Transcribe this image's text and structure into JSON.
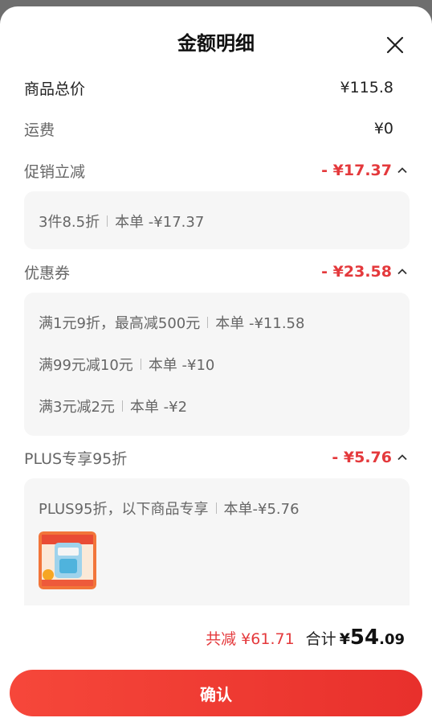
{
  "title": "金额明细",
  "close_icon": "close-icon",
  "rows": {
    "goods_total": {
      "label": "商品总价",
      "amount": "¥115.8"
    },
    "shipping": {
      "label": "运费",
      "amount": "¥0"
    },
    "promo": {
      "label": "促销立减",
      "amount": "- ¥17.37"
    },
    "coupon": {
      "label": "优惠券",
      "amount": "- ¥23.58"
    },
    "plus": {
      "label": "PLUS专享95折",
      "amount": "- ¥5.76"
    }
  },
  "promo_details": [
    {
      "text": "3件8.5折",
      "detail": "本单 -¥17.37"
    }
  ],
  "coupon_details": [
    {
      "text": "满1元9折，最高减500元",
      "detail": "本单 -¥11.58"
    },
    {
      "text": "满99元减10元",
      "detail": "本单 -¥10"
    },
    {
      "text": "满3元减2元",
      "detail": "本单 -¥2"
    }
  ],
  "plus_details": [
    {
      "text": "PLUS95折，以下商品专享",
      "detail": "本单-¥5.76"
    }
  ],
  "footer": {
    "saved": "共减 ¥61.71",
    "total_label": "合计",
    "total_yen": "¥",
    "total_int": "54",
    "total_dec": ".09",
    "confirm": "确认"
  },
  "colors": {
    "accent": "#e4393c",
    "button": "#f0392f",
    "card_bg": "#f6f6f6"
  }
}
